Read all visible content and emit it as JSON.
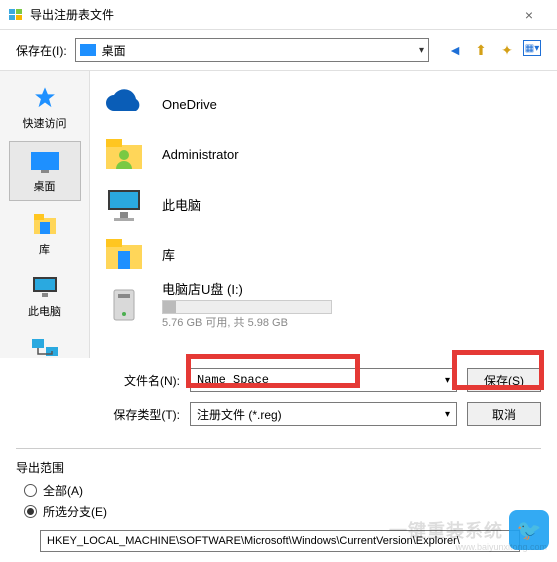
{
  "window": {
    "title": "导出注册表文件",
    "close": "×"
  },
  "toolbar": {
    "save_in_label": "保存在(I):",
    "location": "桌面",
    "icons": {
      "back": "←",
      "up": "↥",
      "new": "📁",
      "view": "▦"
    }
  },
  "sidebar": {
    "items": [
      {
        "label": "快速访问"
      },
      {
        "label": "桌面"
      },
      {
        "label": "库"
      },
      {
        "label": "此电脑"
      },
      {
        "label": "网络"
      }
    ]
  },
  "files": {
    "items": [
      {
        "label": "OneDrive"
      },
      {
        "label": "Administrator"
      },
      {
        "label": "此电脑"
      },
      {
        "label": "库"
      },
      {
        "label": "电脑店U盘 (I:)",
        "sub": "5.76 GB 可用, 共 5.98 GB"
      }
    ]
  },
  "form": {
    "filename_label": "文件名(N):",
    "filename_value": "Name Space",
    "filetype_label": "保存类型(T):",
    "filetype_value": "注册文件 (*.reg)",
    "save_btn": "保存(S)",
    "cancel_btn": "取消"
  },
  "export": {
    "group_label": "导出范围",
    "all_label": "全部(A)",
    "branch_label": "所选分支(E)",
    "path": "HKEY_LOCAL_MACHINE\\SOFTWARE\\Microsoft\\Windows\\CurrentVersion\\Explorer\\"
  },
  "watermark": {
    "text": "一键重装系统",
    "url": "www.baiyunxitong.com"
  }
}
